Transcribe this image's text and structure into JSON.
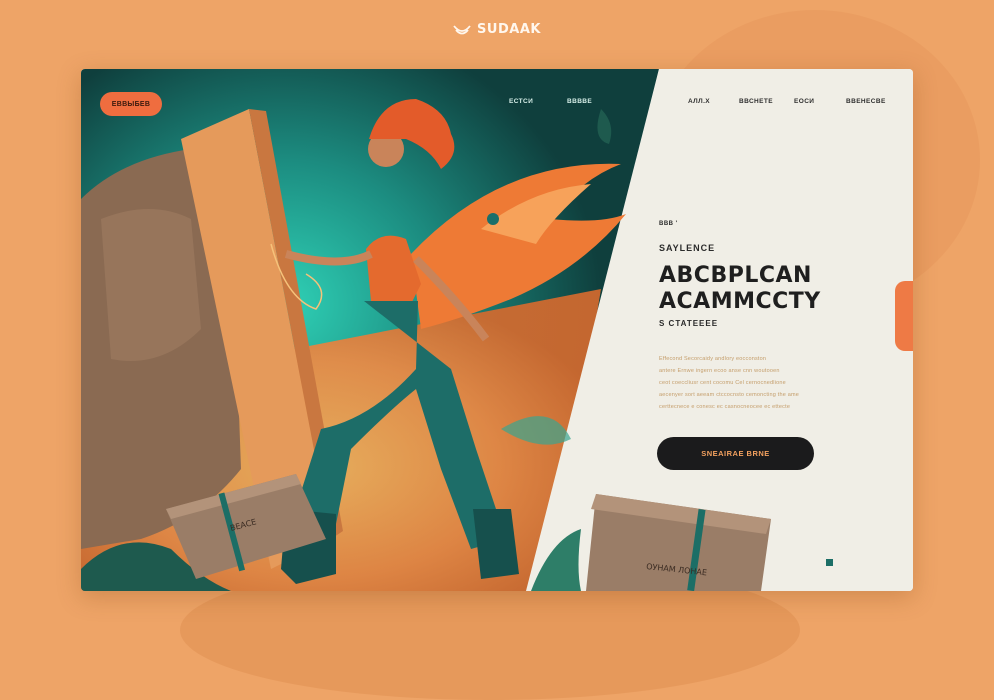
{
  "brand": {
    "name": "SUDAAK"
  },
  "header": {
    "pill_button": "ЕВВЫБЕВ"
  },
  "nav": {
    "left": [
      "ЕСТСИ",
      "ВВВВЕ"
    ],
    "right": [
      "АЛЛ.Х",
      "ВВСНЕТЕ",
      "ЕОСИ",
      "ВВЕНЕСВЕ"
    ]
  },
  "hero": {
    "eyebrow_small": "ВВВ  '",
    "eyebrow": "SAYLENCE",
    "headline_line1": "ABCBPLCAN",
    "headline_line2": "ACAMMCCTY",
    "subheadline": "S CTATEEEE",
    "body_lines": [
      "Effecond Secorcaidy andlory eocconston",
      "antere Ernwe ingern ecoo anse cnn woutooen",
      "ceot coeccliusr cent cocomu Cel cernocnedlione",
      "aecenyer sort aeeam ctccocnsto cemoncting the ame",
      "certtecnece e conesc ec casnocneocee ec ettecte"
    ],
    "cta_label": "SNEAIRAE BRNE"
  },
  "artwork": {
    "crate_label_left": "ВЕАСЕ",
    "crate_label_right": "ОУНАМ  ЛОНАЕ"
  },
  "colors": {
    "background": "#eea467",
    "accent_orange": "#ef6d3f",
    "teal": "#1a6f6a",
    "dark": "#1b1b1c",
    "panel": "#f0eee6"
  }
}
